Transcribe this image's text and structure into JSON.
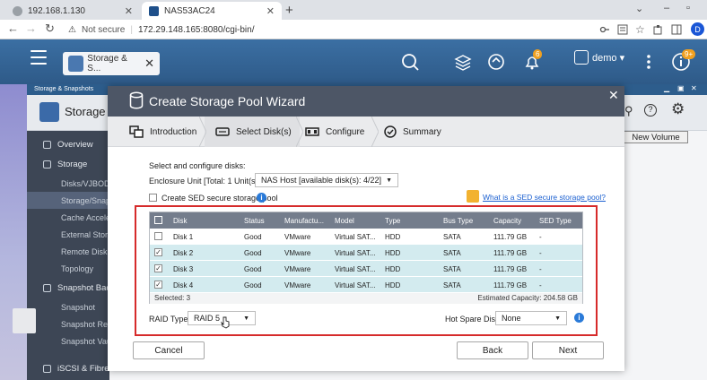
{
  "browser": {
    "tabs": [
      {
        "title": "192.168.1.130",
        "active": false
      },
      {
        "title": "NAS53AC24",
        "active": true
      }
    ],
    "new_tab": "+",
    "address": {
      "security": "Not secure",
      "url": "172.29.148.165:8080/cgi-bin/"
    },
    "profile_initial": "D"
  },
  "qts": {
    "app_tab_label": "Storage & S...",
    "user": "demo ▾",
    "notifications_badge": "6",
    "extra_badge": "9+"
  },
  "app": {
    "window_title": "Storage & Snapshots",
    "header_title": "Storage & S",
    "new_volume_label": "New Volume",
    "sidebar": [
      {
        "label": "Overview",
        "type": "header",
        "selected": false
      },
      {
        "label": "Storage",
        "type": "header",
        "selected": false
      },
      {
        "label": "Disks/VJBOD",
        "type": "sub",
        "selected": false
      },
      {
        "label": "Storage/Snap",
        "type": "sub",
        "selected": true
      },
      {
        "label": "Cache Accele",
        "type": "sub",
        "selected": false
      },
      {
        "label": "External Stora",
        "type": "sub",
        "selected": false
      },
      {
        "label": "Remote Disk",
        "type": "sub",
        "selected": false
      },
      {
        "label": "Topology",
        "type": "sub",
        "selected": false
      },
      {
        "label": "Snapshot Bac",
        "type": "header",
        "selected": false
      },
      {
        "label": "Snapshot",
        "type": "sub",
        "selected": false
      },
      {
        "label": "Snapshot Rep",
        "type": "sub",
        "selected": false
      },
      {
        "label": "Snapshot Vau",
        "type": "sub",
        "selected": false
      },
      {
        "label": "iSCSI & Fibre",
        "type": "header",
        "selected": false
      }
    ]
  },
  "wizard": {
    "title": "Create Storage Pool Wizard",
    "steps": [
      {
        "label": "Introduction",
        "active": false
      },
      {
        "label": "Select Disk(s)",
        "active": true
      },
      {
        "label": "Configure",
        "active": false
      },
      {
        "label": "Summary",
        "active": false
      }
    ],
    "section_label": "Select and configure disks:",
    "enclosure_label": "Enclosure Unit [Total: 1 Unit(s)]:",
    "enclosure_value": "NAS Host [available disk(s): 4/22]",
    "sed_checkbox_label": "Create SED secure storage pool",
    "sed_link": "What is a SED secure storage pool?",
    "table": {
      "columns": [
        "Disk",
        "Status",
        "Manufactu...",
        "Model",
        "Type",
        "Bus Type",
        "Capacity",
        "SED Type"
      ],
      "rows": [
        {
          "checked": false,
          "cells": [
            "Disk 1",
            "Good",
            "VMware",
            "Virtual SAT...",
            "HDD",
            "SATA",
            "111.79 GB",
            "-"
          ]
        },
        {
          "checked": true,
          "cells": [
            "Disk 2",
            "Good",
            "VMware",
            "Virtual SAT...",
            "HDD",
            "SATA",
            "111.79 GB",
            "-"
          ]
        },
        {
          "checked": true,
          "cells": [
            "Disk 3",
            "Good",
            "VMware",
            "Virtual SAT...",
            "HDD",
            "SATA",
            "111.79 GB",
            "-"
          ]
        },
        {
          "checked": true,
          "cells": [
            "Disk 4",
            "Good",
            "VMware",
            "Virtual SAT...",
            "HDD",
            "SATA",
            "111.79 GB",
            "-"
          ]
        }
      ],
      "selected_text": "Selected: 3",
      "estimated_capacity": "Estimated Capacity: 204.58 GB"
    },
    "raid_label": "RAID Type:",
    "raid_value": "RAID 5",
    "hot_spare_label": "Hot Spare Disk:",
    "hot_spare_value": "None",
    "buttons": {
      "cancel": "Cancel",
      "back": "Back",
      "next": "Next"
    }
  },
  "colors": {
    "highlight": "#d62b2b",
    "wizard_header": "#4d5666",
    "selected_row": "#d3ebef",
    "accent_blue": "#2a7ad8"
  }
}
